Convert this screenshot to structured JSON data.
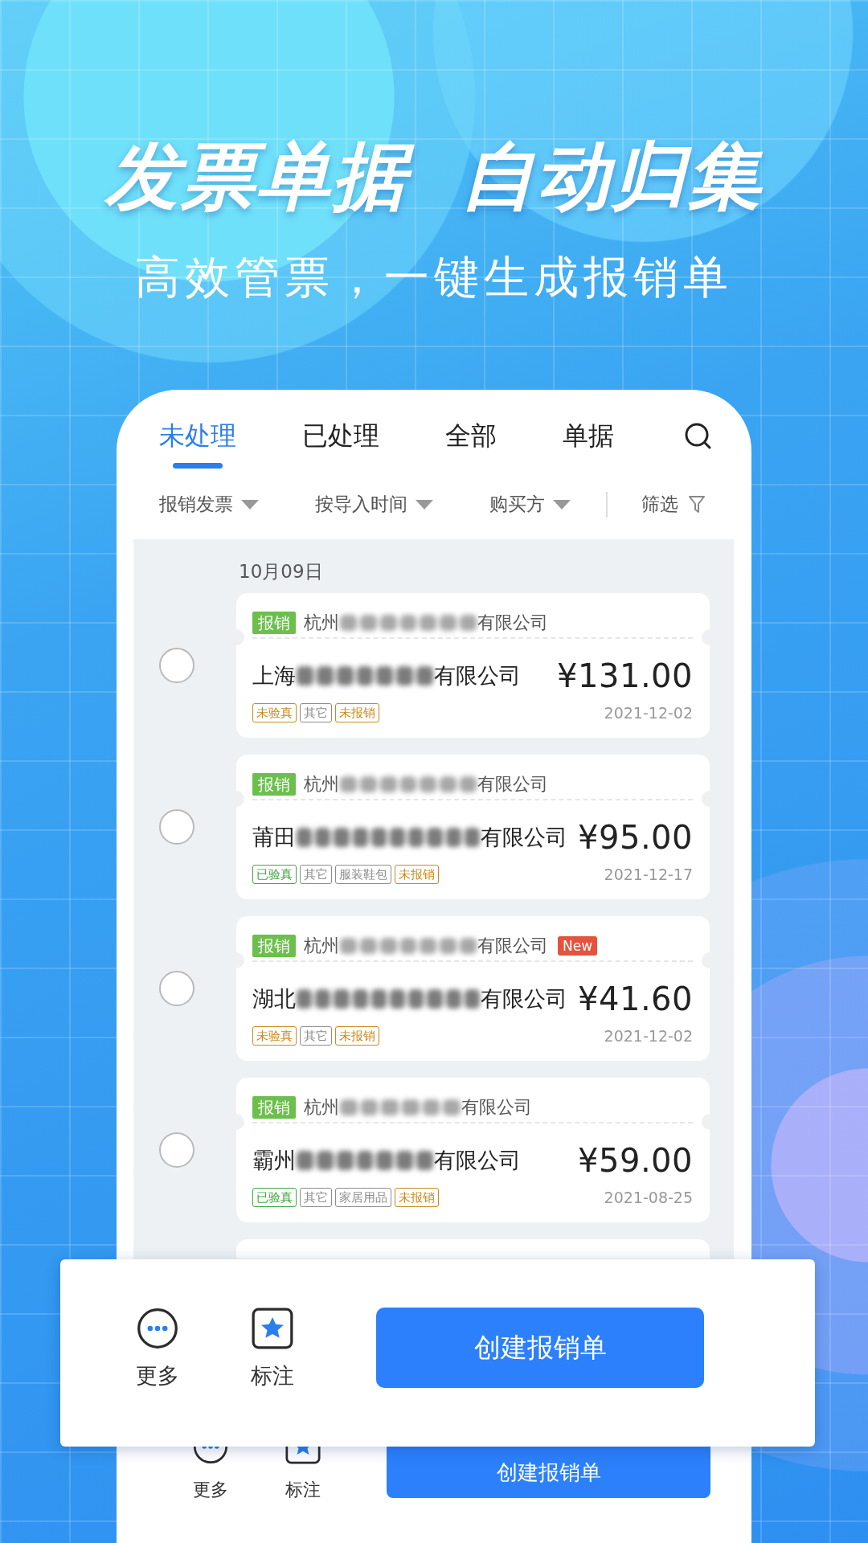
{
  "headline": [
    "发票单据",
    "自动归集"
  ],
  "subtitle": "高效管票，一键生成报销单",
  "tabs": [
    {
      "label": "未处理",
      "selected": true
    },
    {
      "label": "已处理",
      "selected": false
    },
    {
      "label": "全部",
      "selected": false
    },
    {
      "label": "单据",
      "selected": false
    }
  ],
  "filters": [
    {
      "label": "报销发票",
      "kind": "dropdown"
    },
    {
      "label": "按导入时间",
      "kind": "dropdown"
    },
    {
      "label": "购买方",
      "kind": "dropdown"
    },
    {
      "label": "筛选",
      "kind": "filter"
    }
  ],
  "date_header": "10月09日",
  "invoices": [
    {
      "selected": false,
      "type_tag": "报销",
      "seller": {
        "prefix": "杭州",
        "suffix": "有限公司"
      },
      "buyer": {
        "prefix": "上海",
        "suffix": "有限公司"
      },
      "amount": "¥131.00",
      "date": "2021-12-02",
      "tags": [
        {
          "label": "未验真",
          "color": "#c98a1e"
        },
        {
          "label": "其它",
          "color": "#8c8c8c"
        },
        {
          "label": "未报销",
          "color": "#c98a1e"
        }
      ]
    },
    {
      "selected": false,
      "type_tag": "报销",
      "seller": {
        "prefix": "杭州",
        "suffix": "有限公司"
      },
      "buyer": {
        "prefix": "莆田",
        "suffix": "有限公司"
      },
      "amount": "¥95.00",
      "date": "2021-12-17",
      "tags": [
        {
          "label": "已验真",
          "color": "#3fa83f"
        },
        {
          "label": "其它",
          "color": "#8c8c8c"
        },
        {
          "label": "服装鞋包",
          "color": "#8c8c8c"
        },
        {
          "label": "未报销",
          "color": "#c98a1e"
        }
      ]
    },
    {
      "selected": false,
      "type_tag": "报销",
      "seller": {
        "prefix": "杭州",
        "suffix": "有限公司"
      },
      "badge": "New",
      "buyer": {
        "prefix": "湖北",
        "suffix": "有限公司"
      },
      "amount": "¥41.60",
      "date": "2021-12-02",
      "tags": [
        {
          "label": "未验真",
          "color": "#c98a1e"
        },
        {
          "label": "其它",
          "color": "#8c8c8c"
        },
        {
          "label": "未报销",
          "color": "#c98a1e"
        }
      ]
    },
    {
      "selected": false,
      "type_tag": "报销",
      "seller": {
        "prefix": "杭州",
        "suffix": "有限公司"
      },
      "buyer": {
        "prefix": "霸州",
        "suffix": "有限公司"
      },
      "amount": "¥59.00",
      "date": "2021-08-25",
      "tags": [
        {
          "label": "已验真",
          "color": "#3fa83f"
        },
        {
          "label": "其它",
          "color": "#8c8c8c"
        },
        {
          "label": "家居用品",
          "color": "#8c8c8c"
        },
        {
          "label": "未报销",
          "color": "#c98a1e"
        }
      ]
    }
  ],
  "bottom_bar": {
    "actions": [
      {
        "label": "更多",
        "kind": "more"
      },
      {
        "label": "标注",
        "kind": "mark"
      }
    ],
    "button": "创建报销单"
  },
  "callout_bar": {
    "actions": [
      {
        "label": "更多",
        "kind": "more"
      },
      {
        "label": "标注",
        "kind": "mark"
      }
    ],
    "button": "创建报销单"
  }
}
